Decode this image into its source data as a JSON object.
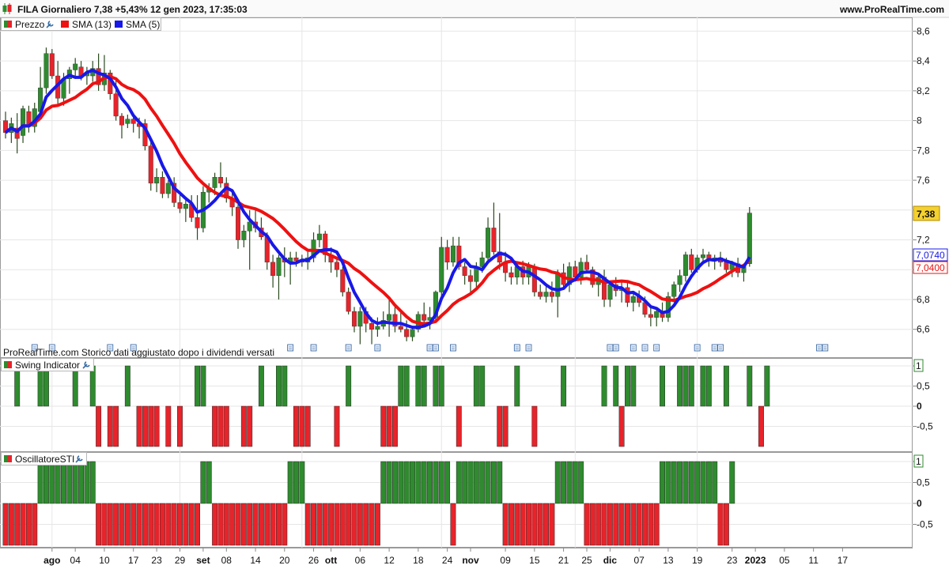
{
  "header": {
    "title": "FILA Giornaliero 7,38 +5,43% 12 gen 2023, 17:35:03",
    "site": "www.ProRealTime.com"
  },
  "legend": {
    "price": "Prezzo",
    "sma13": "SMA (13)",
    "sma5": "SMA (5)",
    "swing": "Swing Indicator",
    "osc": "OscillatoreSTI"
  },
  "note": "ProRealTime.com Storico dati aggiustato dopo i dividendi versati",
  "colors": {
    "up": "#2e8b2e",
    "down": "#e8232a",
    "sma13": "#ee1111",
    "sma5": "#1818e8",
    "last_price_badge": "#f5d130"
  },
  "icons": [
    "wrench-icon",
    "document-icon"
  ],
  "chart_data": [
    {
      "type": "candlestick",
      "title": "Prezzo",
      "y_ticks": [
        "8,6",
        "8,4",
        "8,2",
        "8",
        "7,8",
        "7,6",
        "7,4",
        "7,2",
        "7",
        "6,8",
        "6,6"
      ],
      "ylim": [
        6.45,
        8.65
      ],
      "price_labels": {
        "last": "7,38",
        "sma5": "7,0740",
        "sma13": "7,0400"
      },
      "last_value": 7.38,
      "sma5_value": 7.074,
      "sma13_value": 7.04,
      "x_labels": [
        "ago",
        "04",
        "10",
        "17",
        "23",
        "29",
        "set",
        "08",
        "14",
        "20",
        "26",
        "ott",
        "06",
        "12",
        "18",
        "24",
        "nov",
        "09",
        "15",
        "21",
        "25",
        "dic",
        "07",
        "13",
        "19",
        "23",
        "2023",
        "05",
        "11",
        "17"
      ],
      "bold_x_labels": [
        "ago",
        "set",
        "ott",
        "nov",
        "dic",
        "2023"
      ],
      "ohlc": [
        [
          8.0,
          8.06,
          7.88,
          7.92
        ],
        [
          7.92,
          8.02,
          7.85,
          7.98
        ],
        [
          7.95,
          8.05,
          7.78,
          7.88
        ],
        [
          7.9,
          8.1,
          7.85,
          8.08
        ],
        [
          8.06,
          8.1,
          7.92,
          7.96
        ],
        [
          7.96,
          8.12,
          7.92,
          8.08
        ],
        [
          8.06,
          8.36,
          8.02,
          8.22
        ],
        [
          8.22,
          8.49,
          8.18,
          8.45
        ],
        [
          8.45,
          8.48,
          8.28,
          8.3
        ],
        [
          8.3,
          8.4,
          8.1,
          8.15
        ],
        [
          8.15,
          8.32,
          8.1,
          8.28
        ],
        [
          8.28,
          8.36,
          8.18,
          8.34
        ],
        [
          8.34,
          8.42,
          8.28,
          8.38
        ],
        [
          8.36,
          8.4,
          8.27,
          8.3
        ],
        [
          8.3,
          8.36,
          8.24,
          8.32
        ],
        [
          8.3,
          8.4,
          8.26,
          8.35
        ],
        [
          8.35,
          8.45,
          8.2,
          8.24
        ],
        [
          8.24,
          8.44,
          8.2,
          8.32
        ],
        [
          8.32,
          8.34,
          8.14,
          8.18
        ],
        [
          8.18,
          8.28,
          8.0,
          8.03
        ],
        [
          8.03,
          8.05,
          7.88,
          7.97
        ],
        [
          7.98,
          8.04,
          7.95,
          8.01
        ],
        [
          8.01,
          8.03,
          7.92,
          7.98
        ],
        [
          7.98,
          8.02,
          7.88,
          7.96
        ],
        [
          7.98,
          8.01,
          7.8,
          7.83
        ],
        [
          7.83,
          7.86,
          7.53,
          7.58
        ],
        [
          7.58,
          7.68,
          7.52,
          7.62
        ],
        [
          7.62,
          7.66,
          7.48,
          7.51
        ],
        [
          7.51,
          7.6,
          7.48,
          7.58
        ],
        [
          7.58,
          7.62,
          7.42,
          7.45
        ],
        [
          7.45,
          7.5,
          7.38,
          7.41
        ],
        [
          7.41,
          7.48,
          7.32,
          7.44
        ],
        [
          7.44,
          7.5,
          7.32,
          7.35
        ],
        [
          7.35,
          7.5,
          7.2,
          7.28
        ],
        [
          7.28,
          7.56,
          7.25,
          7.52
        ],
        [
          7.52,
          7.58,
          7.45,
          7.55
        ],
        [
          7.55,
          7.65,
          7.5,
          7.62
        ],
        [
          7.62,
          7.72,
          7.55,
          7.58
        ],
        [
          7.58,
          7.62,
          7.45,
          7.48
        ],
        [
          7.48,
          7.52,
          7.36,
          7.42
        ],
        [
          7.42,
          7.45,
          7.14,
          7.2
        ],
        [
          7.2,
          7.3,
          7.15,
          7.26
        ],
        [
          7.26,
          7.4,
          7.0,
          7.32
        ],
        [
          7.32,
          7.4,
          7.25,
          7.28
        ],
        [
          7.28,
          7.35,
          7.2,
          7.22
        ],
        [
          7.22,
          7.25,
          7.0,
          7.05
        ],
        [
          7.05,
          7.1,
          6.88,
          6.96
        ],
        [
          6.96,
          7.1,
          6.8,
          7.08
        ],
        [
          7.08,
          7.15,
          6.95,
          7.05
        ],
        [
          7.05,
          7.12,
          6.9,
          7.08
        ],
        [
          7.08,
          7.12,
          7.02,
          7.06
        ],
        [
          7.06,
          7.1,
          7.02,
          7.05
        ],
        [
          7.05,
          7.12,
          7.0,
          7.08
        ],
        [
          7.08,
          7.25,
          7.05,
          7.2
        ],
        [
          7.2,
          7.3,
          7.15,
          7.24
        ],
        [
          7.24,
          7.26,
          7.05,
          7.1
        ],
        [
          7.1,
          7.15,
          6.98,
          7.05
        ],
        [
          7.05,
          7.08,
          6.95,
          7.0
        ],
        [
          7.0,
          7.02,
          6.82,
          6.85
        ],
        [
          6.85,
          6.88,
          6.7,
          6.72
        ],
        [
          6.72,
          6.75,
          6.58,
          6.62
        ],
        [
          6.62,
          6.75,
          6.5,
          6.72
        ],
        [
          6.72,
          6.75,
          6.58,
          6.64
        ],
        [
          6.64,
          6.68,
          6.5,
          6.6
        ],
        [
          6.6,
          6.68,
          6.55,
          6.62
        ],
        [
          6.62,
          6.72,
          6.6,
          6.66
        ],
        [
          6.66,
          6.8,
          6.55,
          6.7
        ],
        [
          6.7,
          6.75,
          6.58,
          6.62
        ],
        [
          6.62,
          6.72,
          6.58,
          6.6
        ],
        [
          6.6,
          6.66,
          6.52,
          6.55
        ],
        [
          6.55,
          6.62,
          6.52,
          6.6
        ],
        [
          6.6,
          6.72,
          6.58,
          6.7
        ],
        [
          6.7,
          6.78,
          6.62,
          6.66
        ],
        [
          6.66,
          6.75,
          6.6,
          6.68
        ],
        [
          6.68,
          6.86,
          6.65,
          6.85
        ],
        [
          6.85,
          7.22,
          6.82,
          7.15
        ],
        [
          7.15,
          7.2,
          7.0,
          7.05
        ],
        [
          7.05,
          7.22,
          7.02,
          7.16
        ],
        [
          7.16,
          7.22,
          7.0,
          7.02
        ],
        [
          7.02,
          7.05,
          6.9,
          6.96
        ],
        [
          6.96,
          7.0,
          6.85,
          6.92
        ],
        [
          6.92,
          7.05,
          6.88,
          7.02
        ],
        [
          7.02,
          7.12,
          6.98,
          7.08
        ],
        [
          7.08,
          7.35,
          7.05,
          7.28
        ],
        [
          7.28,
          7.45,
          7.1,
          7.12
        ],
        [
          7.12,
          7.38,
          7.0,
          7.05
        ],
        [
          7.05,
          7.12,
          6.92,
          6.98
        ],
        [
          6.98,
          7.02,
          6.9,
          6.95
        ],
        [
          6.95,
          7.05,
          6.9,
          7.02
        ],
        [
          7.02,
          7.06,
          6.9,
          6.95
        ],
        [
          6.95,
          7.05,
          6.9,
          7.02
        ],
        [
          7.02,
          7.04,
          6.82,
          6.85
        ],
        [
          6.85,
          6.9,
          6.8,
          6.82
        ],
        [
          6.82,
          6.9,
          6.78,
          6.85
        ],
        [
          6.85,
          6.92,
          6.78,
          6.82
        ],
        [
          6.82,
          7.0,
          6.68,
          6.98
        ],
        [
          6.98,
          7.04,
          6.88,
          6.9
        ],
        [
          6.9,
          7.05,
          6.85,
          7.02
        ],
        [
          7.02,
          7.06,
          6.92,
          6.95
        ],
        [
          6.95,
          7.08,
          6.9,
          7.05
        ],
        [
          7.05,
          7.1,
          6.98,
          7.0
        ],
        [
          7.0,
          7.02,
          6.88,
          6.9
        ],
        [
          6.9,
          6.98,
          6.82,
          6.95
        ],
        [
          6.95,
          7.0,
          6.75,
          6.8
        ],
        [
          6.8,
          6.85,
          6.75,
          6.9
        ],
        [
          6.9,
          6.95,
          6.82,
          6.86
        ],
        [
          6.86,
          6.92,
          6.78,
          6.88
        ],
        [
          6.88,
          6.92,
          6.75,
          6.78
        ],
        [
          6.78,
          6.85,
          6.72,
          6.82
        ],
        [
          6.82,
          6.86,
          6.75,
          6.78
        ],
        [
          6.78,
          6.82,
          6.68,
          6.7
        ],
        [
          6.7,
          6.75,
          6.62,
          6.68
        ],
        [
          6.68,
          6.74,
          6.62,
          6.72
        ],
        [
          6.72,
          6.78,
          6.65,
          6.68
        ],
        [
          6.68,
          6.85,
          6.65,
          6.82
        ],
        [
          6.82,
          6.92,
          6.78,
          6.9
        ],
        [
          6.9,
          7.0,
          6.85,
          6.96
        ],
        [
          6.96,
          7.12,
          6.92,
          7.1
        ],
        [
          7.1,
          7.14,
          6.98,
          7.0
        ],
        [
          7.0,
          7.1,
          6.98,
          7.08
        ],
        [
          7.08,
          7.14,
          7.05,
          7.1
        ],
        [
          7.1,
          7.12,
          7.02,
          7.06
        ],
        [
          7.06,
          7.1,
          7.0,
          7.08
        ],
        [
          7.08,
          7.12,
          7.02,
          7.05
        ],
        [
          7.05,
          7.08,
          6.98,
          7.0
        ],
        [
          7.0,
          7.06,
          6.95,
          7.04
        ],
        [
          7.04,
          7.08,
          6.95,
          6.98
        ],
        [
          6.98,
          7.04,
          6.92,
          7.02
        ],
        [
          7.04,
          7.42,
          7.02,
          7.38
        ]
      ]
    },
    {
      "type": "bar",
      "title": "Swing Indicator",
      "y_ticks": [
        "1",
        "0,5",
        "0",
        "-0,5"
      ],
      "ylim": [
        -1,
        1
      ],
      "values": [
        0,
        0,
        1,
        0,
        0,
        0,
        1,
        1,
        0,
        0,
        0,
        0,
        1,
        0,
        0,
        1,
        -1,
        0,
        -1,
        -1,
        0,
        1,
        0,
        -1,
        -1,
        -1,
        -1,
        0,
        -1,
        0,
        -1,
        0,
        0,
        1,
        1,
        0,
        -1,
        -1,
        -1,
        0,
        0,
        -1,
        -1,
        0,
        1,
        0,
        0,
        1,
        1,
        0,
        -1,
        -1,
        -1,
        0,
        0,
        0,
        0,
        -1,
        0,
        1,
        0,
        0,
        0,
        0,
        0,
        -1,
        -1,
        -1,
        1,
        1,
        0,
        1,
        1,
        0,
        1,
        1,
        0,
        0,
        -1,
        0,
        0,
        1,
        1,
        0,
        0,
        -1,
        -1,
        0,
        1,
        0,
        0,
        -1,
        0,
        0,
        0,
        0,
        1,
        0,
        0,
        0,
        0,
        0,
        0,
        1,
        0,
        1,
        -1,
        1,
        1,
        0,
        0,
        0,
        0,
        1,
        0,
        0,
        1,
        1,
        1,
        0,
        1,
        1,
        0,
        0,
        1,
        0,
        0,
        0,
        1,
        0,
        -1,
        1
      ]
    },
    {
      "type": "bar",
      "title": "OscillatoreSTI",
      "y_ticks": [
        "1",
        "0,5",
        "0",
        "-0,5"
      ],
      "ylim": [
        -1,
        1
      ],
      "values": [
        -1,
        -1,
        -1,
        -1,
        -1,
        -1,
        1,
        1,
        1,
        1,
        1,
        1,
        1,
        1,
        1,
        1,
        -1,
        -1,
        -1,
        -1,
        -1,
        -1,
        -1,
        -1,
        -1,
        -1,
        -1,
        -1,
        -1,
        -1,
        -1,
        -1,
        -1,
        -1,
        1,
        1,
        -1,
        -1,
        -1,
        -1,
        -1,
        -1,
        -1,
        -1,
        -1,
        -1,
        -1,
        -1,
        -1,
        1,
        1,
        1,
        -1,
        -1,
        -1,
        -1,
        -1,
        -1,
        -1,
        -1,
        -1,
        -1,
        -1,
        -1,
        -1,
        1,
        1,
        1,
        1,
        1,
        1,
        1,
        1,
        1,
        1,
        1,
        1,
        -1,
        1,
        1,
        1,
        1,
        1,
        1,
        1,
        1,
        -1,
        -1,
        -1,
        -1,
        -1,
        -1,
        -1,
        -1,
        -1,
        1,
        1,
        1,
        1,
        1,
        -1,
        -1,
        -1,
        -1,
        -1,
        -1,
        -1,
        -1,
        -1,
        -1,
        -1,
        -1,
        -1,
        1,
        1,
        1,
        1,
        1,
        1,
        1,
        1,
        1,
        1,
        -1,
        -1,
        1
      ]
    }
  ]
}
